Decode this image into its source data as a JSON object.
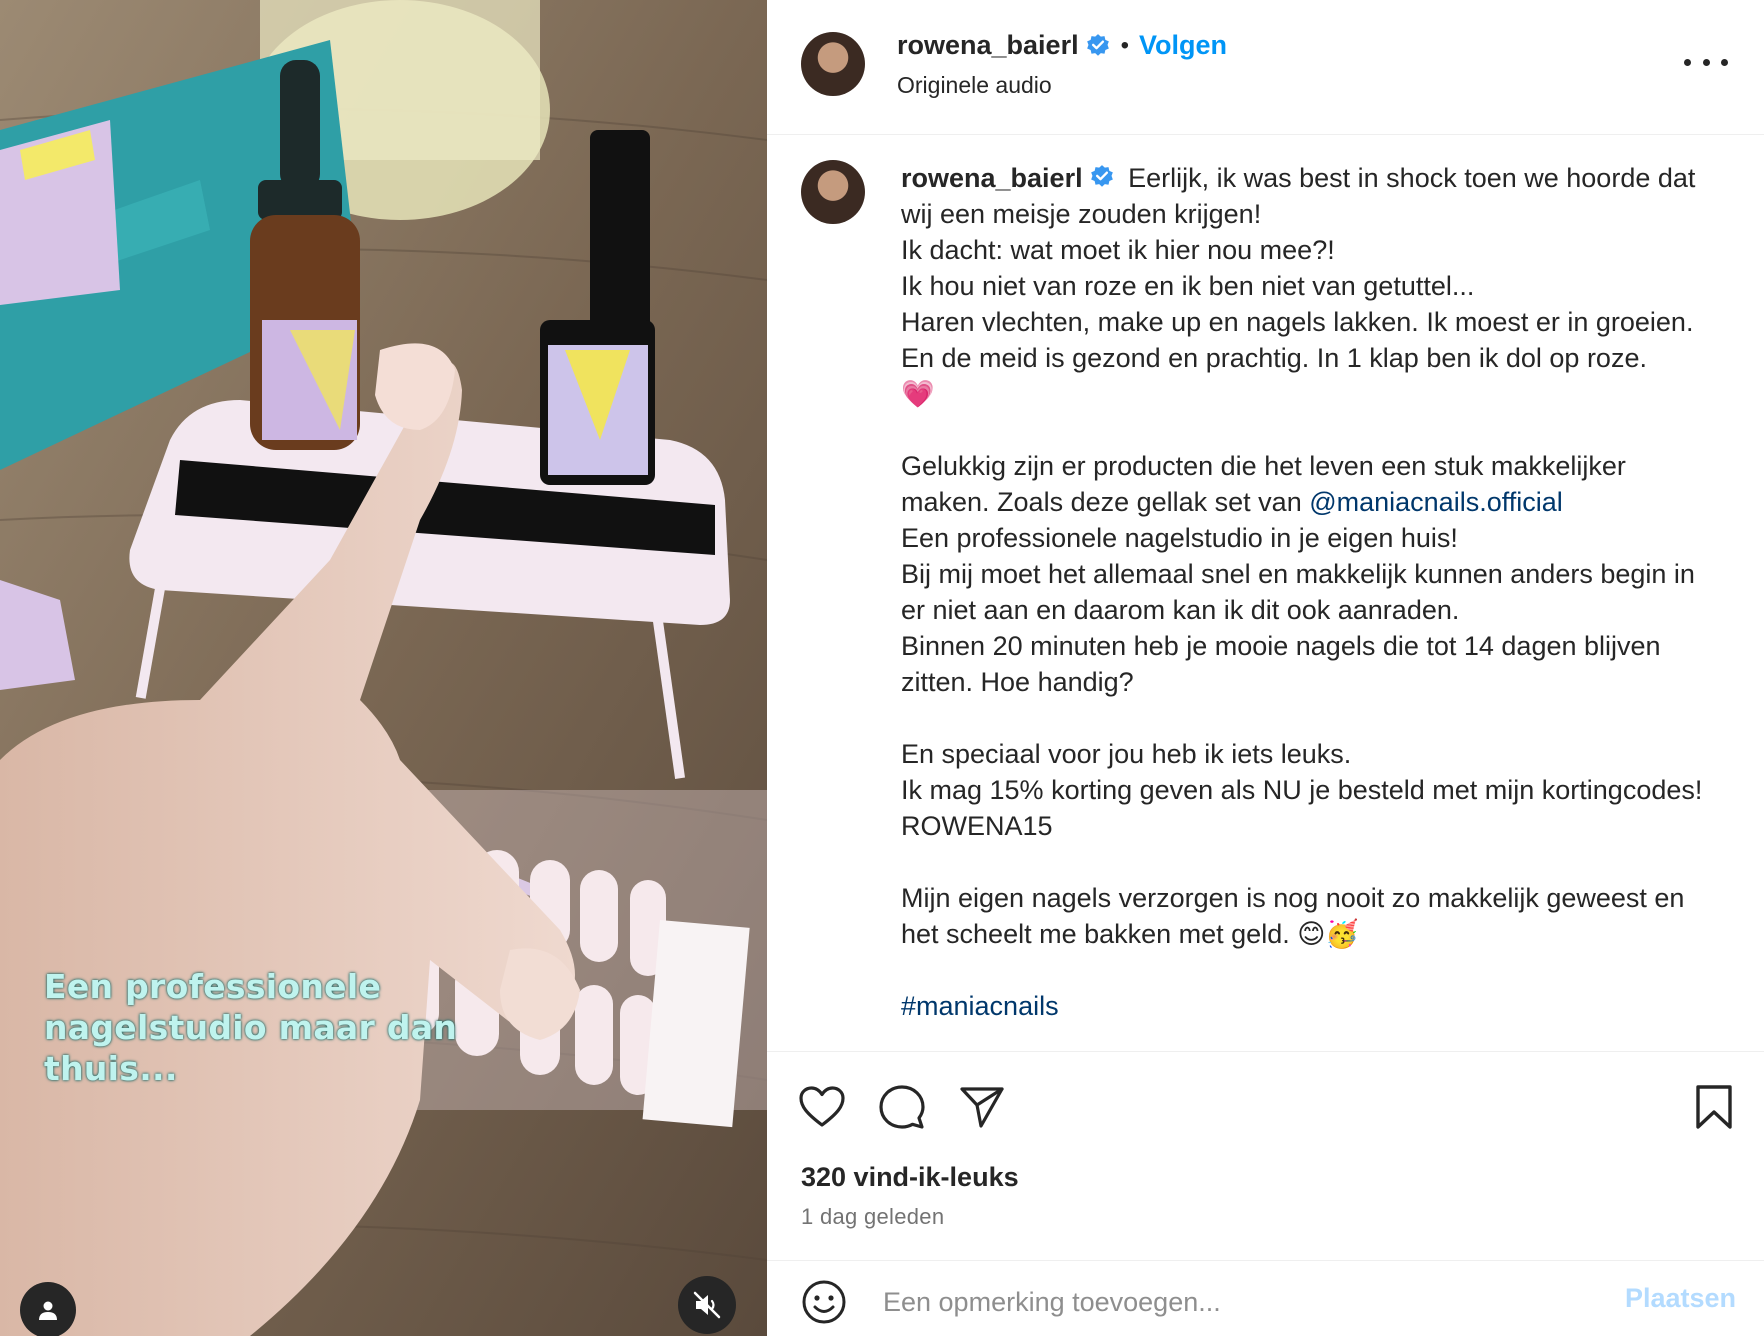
{
  "header": {
    "username": "rowena_baierl",
    "separator": "•",
    "follow_label": "Volgen",
    "subtitle": "Originele audio"
  },
  "video": {
    "overlay_text": "Een professionele nagelstudio maar dan thuis...",
    "profile_button_icon": "user-icon",
    "mute_button_icon": "speaker-muted-icon"
  },
  "caption": {
    "username": "rowena_baierl",
    "lines": [
      "Eerlijk, ik was best in shock toen we hoorde dat wij een meisje zouden krijgen!",
      "Ik dacht: wat moet ik hier nou mee?!",
      "Ik hou niet van roze en ik ben niet van getuttel...",
      "Haren vlechten, make up en nagels lakken. Ik moest er in groeien.",
      "En de meid is gezond en prachtig. In 1 klap ben ik dol op roze.",
      "💗"
    ],
    "paragraph2_before_mention": "Gelukkig zijn er producten die het leven een stuk makkelijker maken. Zoals deze gellak set van ",
    "mention": "@maniacnails.official",
    "paragraph2_rest": [
      "Een professionele nagelstudio in je eigen huis!",
      "Bij mij moet het allemaal snel en makkelijk kunnen anders begin in er niet aan en daarom kan ik dit ook aanraden.",
      "Binnen 20 minuten heb je mooie nagels die tot 14 dagen blijven zitten. Hoe handig?"
    ],
    "paragraph3": [
      "En speciaal voor jou heb ik iets leuks.",
      "Ik mag 15% korting geven als NU je besteld met mijn kortingcodes! ROWENA15"
    ],
    "paragraph4": "Mijn eigen nagels verzorgen is nog nooit zo makkelijk geweest en het scheelt me bakken met geld. 😊🥳",
    "hashtag": "#maniacnails"
  },
  "actions": {
    "likes": "320 vind-ik-leuks",
    "time": "1 dag geleden",
    "comment_placeholder": "Een opmerking toevoegen...",
    "post_label": "Plaatsen"
  },
  "colors": {
    "accent": "#0095f6",
    "verified": "#3897f0",
    "mention": "#00376b",
    "post_disabled": "#b3dbff"
  }
}
